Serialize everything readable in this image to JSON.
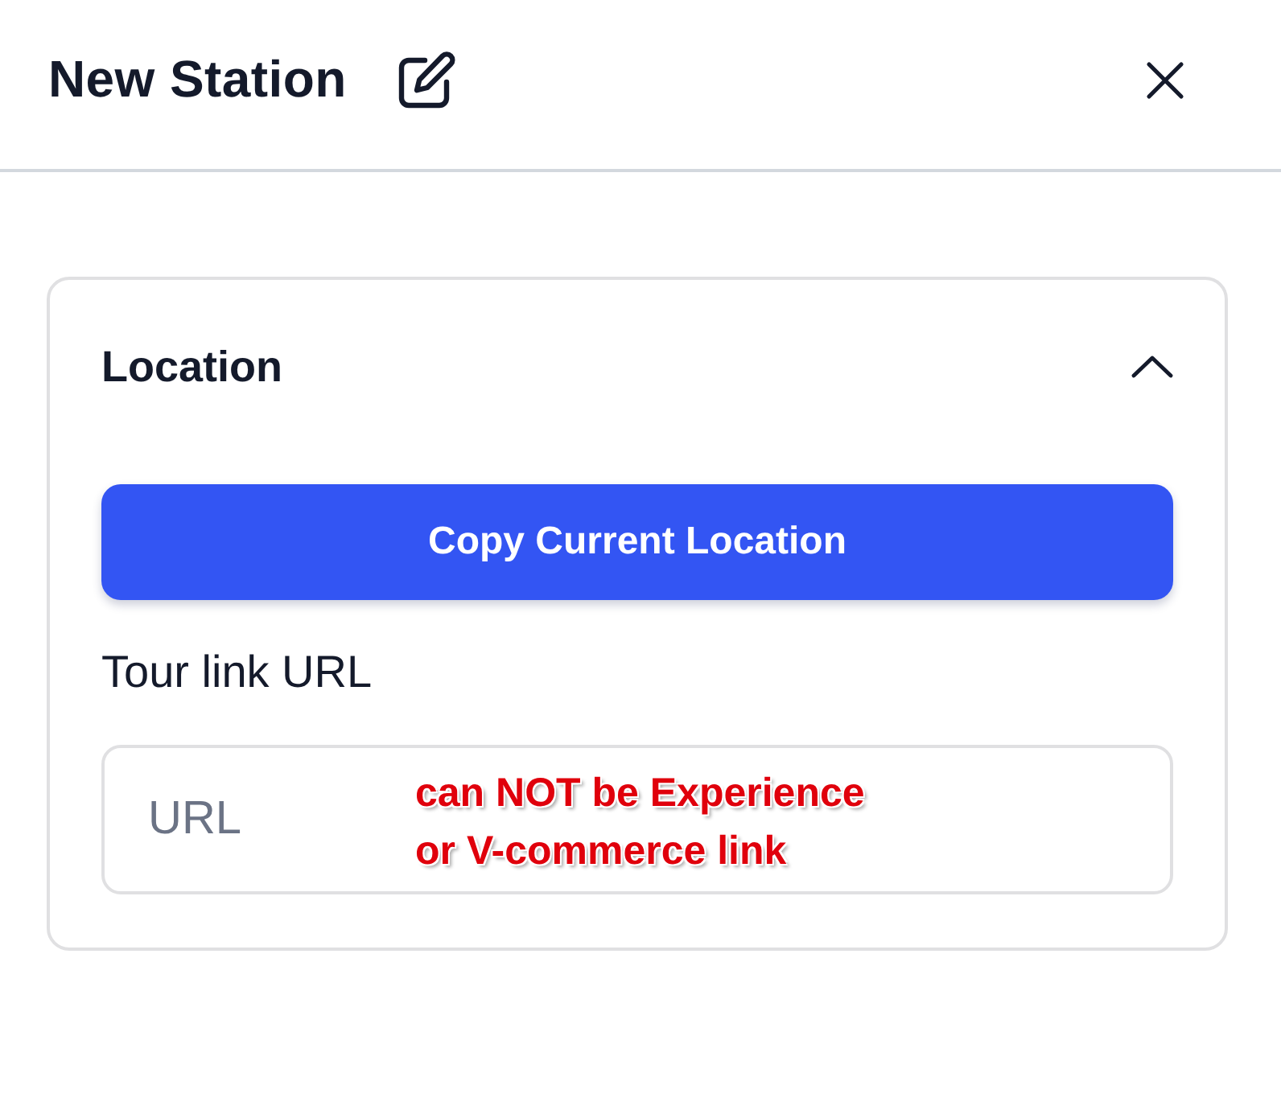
{
  "header": {
    "title": "New Station"
  },
  "section": {
    "title": "Location",
    "expanded": true,
    "button": "Copy Current Location",
    "field": {
      "label": "Tour link URL",
      "placeholder": "URL"
    },
    "annotation": [
      "can NOT be Experience",
      "or V-commerce link"
    ]
  }
}
